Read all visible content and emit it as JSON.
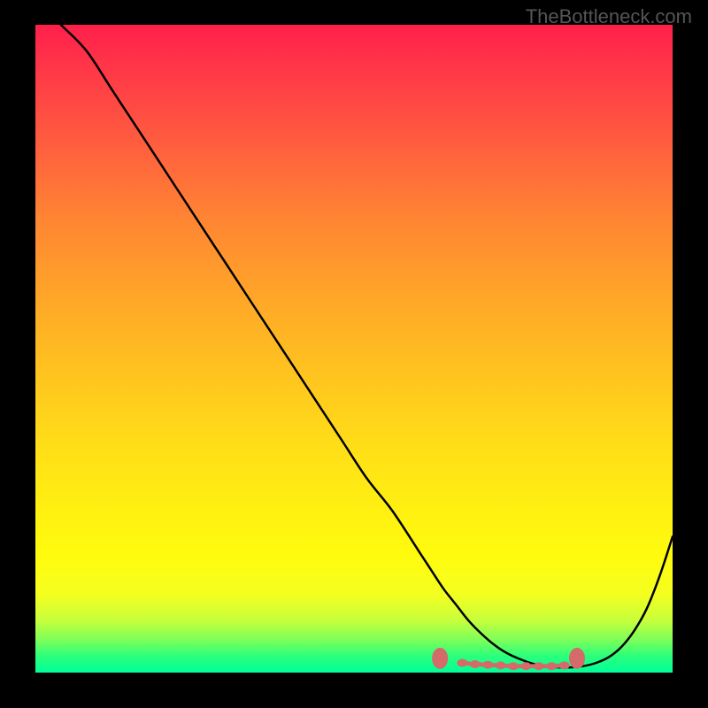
{
  "watermark": "TheBottleneck.com",
  "chart_data": {
    "type": "line",
    "title": "",
    "xlabel": "",
    "ylabel": "",
    "xlim": [
      0,
      100
    ],
    "ylim": [
      0,
      100
    ],
    "series": [
      {
        "name": "bottleneck-curve",
        "color": "#000000",
        "x": [
          4,
          8,
          12,
          16,
          20,
          24,
          28,
          32,
          36,
          40,
          44,
          48,
          52,
          56,
          60,
          62,
          64,
          66,
          68,
          70,
          72,
          74,
          76,
          78,
          80,
          82,
          84,
          86,
          88,
          90,
          92,
          94,
          96,
          98,
          100
        ],
        "values": [
          100,
          96,
          90,
          84,
          78,
          72,
          66,
          60,
          54,
          48,
          42,
          36,
          30,
          25,
          19,
          16,
          13,
          10.5,
          8,
          6,
          4.3,
          3,
          2.1,
          1.4,
          1.0,
          0.8,
          0.8,
          1.0,
          1.5,
          2.4,
          4.0,
          6.5,
          10,
          15,
          21
        ]
      }
    ],
    "markers": {
      "name": "optimal-range",
      "color": "#d46a6a",
      "x": [
        63.5,
        67,
        69,
        71,
        73,
        75,
        77,
        79,
        81,
        83,
        85
      ],
      "values": [
        2.2,
        1.5,
        1.3,
        1.2,
        1.1,
        1.0,
        1.0,
        1.0,
        1.0,
        1.1,
        2.2
      ]
    },
    "gradient_stops": [
      {
        "pos": 0,
        "color": "#ff1f4a"
      },
      {
        "pos": 50,
        "color": "#ffc41f"
      },
      {
        "pos": 85,
        "color": "#fffb0e"
      },
      {
        "pos": 100,
        "color": "#00ff99"
      }
    ]
  }
}
